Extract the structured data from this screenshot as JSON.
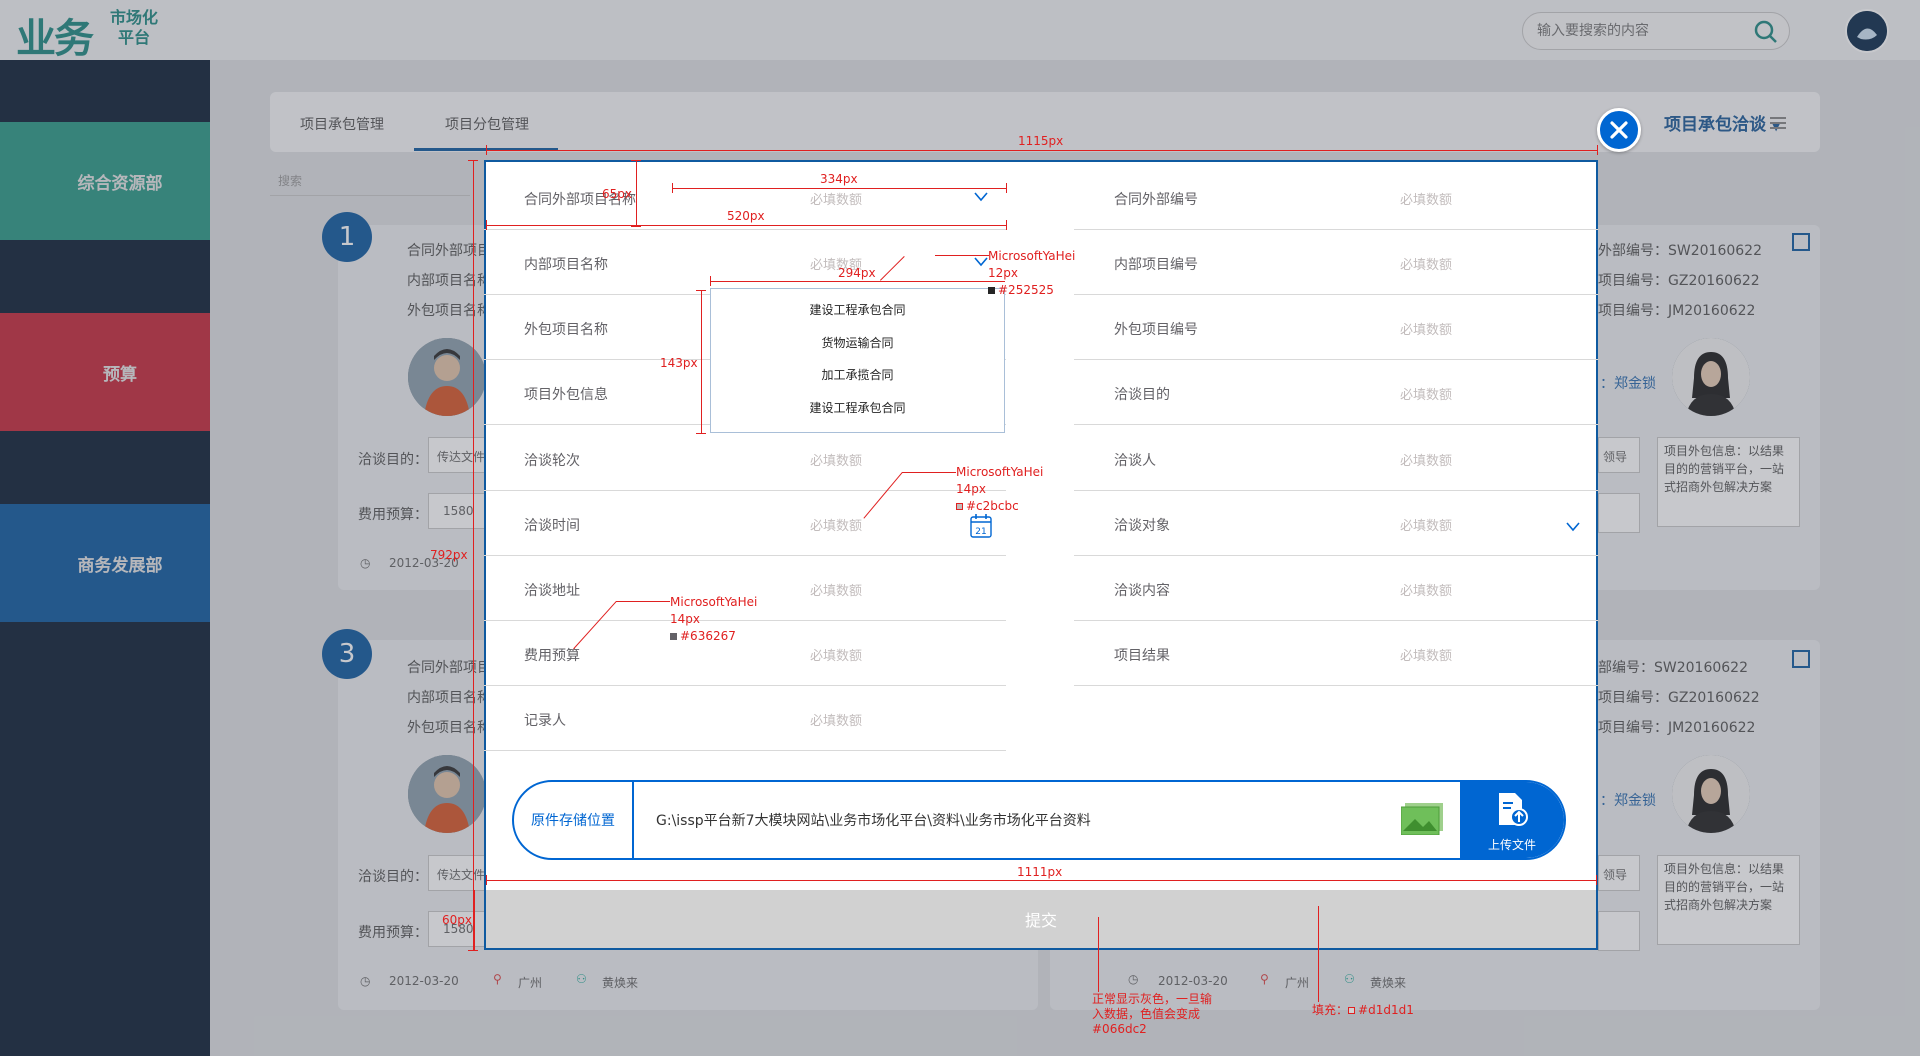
{
  "app": {
    "logo_main": "业务",
    "logo_sub_1": "市场化",
    "logo_sub_2": "平台",
    "search_placeholder": "输入要搜索的内容"
  },
  "sidebar": {
    "items": [
      {
        "label": "综合资源部"
      },
      {
        "label": "预算"
      },
      {
        "label": "商务发展部"
      }
    ]
  },
  "page": {
    "tabs": [
      "项目承包管理",
      "项目分包管理"
    ],
    "right_dropdown": "项目承包洽谈",
    "search_placeholder": "搜索"
  },
  "background_cards": {
    "left_1": {
      "badge": "1",
      "lines": [
        "合同外部项目",
        "内部项目名称",
        "外包项目名称"
      ],
      "purpose_label": "洽谈目的：",
      "purpose_value": "传达文件",
      "budget_label": "费用预算：",
      "budget_value": "1580",
      "date": "2012-03-20"
    },
    "left_3": {
      "badge": "3",
      "lines": [
        "合同外部项目",
        "内部项目名称",
        "外包项目名称"
      ],
      "purpose_label": "洽谈目的：",
      "purpose_value": "传达文件",
      "budget_label": "费用预算：",
      "budget_value": "1580",
      "date": "2012-03-20",
      "city": "广州",
      "person": "黄焕来"
    },
    "right_1": {
      "lines": [
        "外部编号：SW20160622",
        "项目编号：GZ20160622",
        "项目编号：JM20160622"
      ],
      "contact": "：郑金锁",
      "lead": "领导",
      "info": "项目外包信息：以结果目的的营销平台，一站式招商外包解决方案"
    },
    "right_3": {
      "lines": [
        "部编号：SW20160622",
        "项目编号：GZ20160622",
        "项目编号：JM20160622"
      ],
      "contact": "：郑金锁",
      "lead": "领导",
      "info": "项目外包信息：以结果目的的营销平台，一站式招商外包解决方案",
      "date": "2012-03-20",
      "city": "广州",
      "person": "黄焕来"
    }
  },
  "modal": {
    "placeholder": "必填数额",
    "left_fields": [
      {
        "label": "合同外部项目名称"
      },
      {
        "label": "内部项目名称"
      },
      {
        "label": "外包项目名称"
      },
      {
        "label": "项目外包信息"
      },
      {
        "label": "洽谈轮次"
      },
      {
        "label": "洽谈时间"
      },
      {
        "label": "洽谈地址"
      },
      {
        "label": "费用预算"
      },
      {
        "label": "记录人"
      }
    ],
    "right_fields": [
      {
        "label": "合同外部编号"
      },
      {
        "label": "内部项目编号"
      },
      {
        "label": "外包项目编号"
      },
      {
        "label": "洽谈目的"
      },
      {
        "label": "洽谈人"
      },
      {
        "label": "洽谈对象"
      },
      {
        "label": "洽谈内容"
      },
      {
        "label": "项目结果"
      }
    ],
    "dropdown_options": [
      "建设工程承包合同",
      "货物运输合同",
      "加工承揽合同",
      "建设工程承包合同"
    ],
    "calendar_day": "21",
    "upload": {
      "label": "原件存储位置",
      "path": "G:\\issp平台新7大模块网站\\业务市场化平台\\资料\\业务市场化平台资料",
      "button": "上传文件"
    },
    "submit": "提交"
  },
  "annotations": {
    "w_1115": "1115px",
    "w_334": "334px",
    "h_65": "65px",
    "w_520": "520px",
    "w_294": "294px",
    "h_143": "143px",
    "h_792": "792px",
    "w_1111": "1111px",
    "h_60": "60px",
    "font1_name": "MicrosoftYaHei",
    "font1_size": "12px",
    "font1_color": "#252525",
    "font2_name": "MicrosoftYaHei",
    "font2_size": "14px",
    "font2_color": "#c2bcbc",
    "font3_name": "MicrosoftYaHei",
    "font3_size": "14px",
    "font3_color": "#636267",
    "note_submit_1": "正常显示灰色，一旦输",
    "note_submit_2": "入数据，色值会变成",
    "note_submit_3": "#066dc2",
    "note_fill": "填充：",
    "note_fill_color": "#d1d1d1"
  },
  "colors": {
    "primary": "#0066d2",
    "submit_bg": "#d1d1d1",
    "annotation": "#e02020",
    "placeholder": "#c2bcbc",
    "label": "#636267",
    "dropdown_text": "#252525"
  }
}
